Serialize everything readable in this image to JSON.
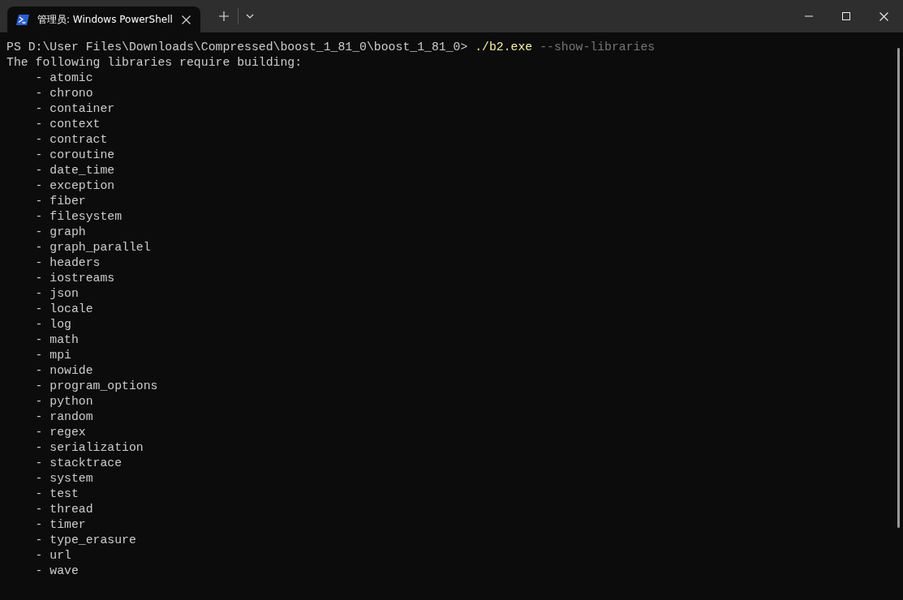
{
  "window": {
    "tabs": [
      {
        "title": "管理员: Windows PowerShell",
        "selected": true
      }
    ]
  },
  "terminal": {
    "prompt": {
      "path": "PS D:\\User Files\\Downloads\\Compressed\\boost_1_81_0\\boost_1_81_0>",
      "command": "./b2.exe",
      "arguments": "--show-libraries"
    },
    "output_header": "The following libraries require building:",
    "libraries": [
      "- atomic",
      "- chrono",
      "- container",
      "- context",
      "- contract",
      "- coroutine",
      "- date_time",
      "- exception",
      "- fiber",
      "- filesystem",
      "- graph",
      "- graph_parallel",
      "- headers",
      "- iostreams",
      "- json",
      "- locale",
      "- log",
      "- math",
      "- mpi",
      "- nowide",
      "- program_options",
      "- python",
      "- random",
      "- regex",
      "- serialization",
      "- stacktrace",
      "- system",
      "- test",
      "- thread",
      "- timer",
      "- type_erasure",
      "- url",
      "- wave"
    ]
  }
}
